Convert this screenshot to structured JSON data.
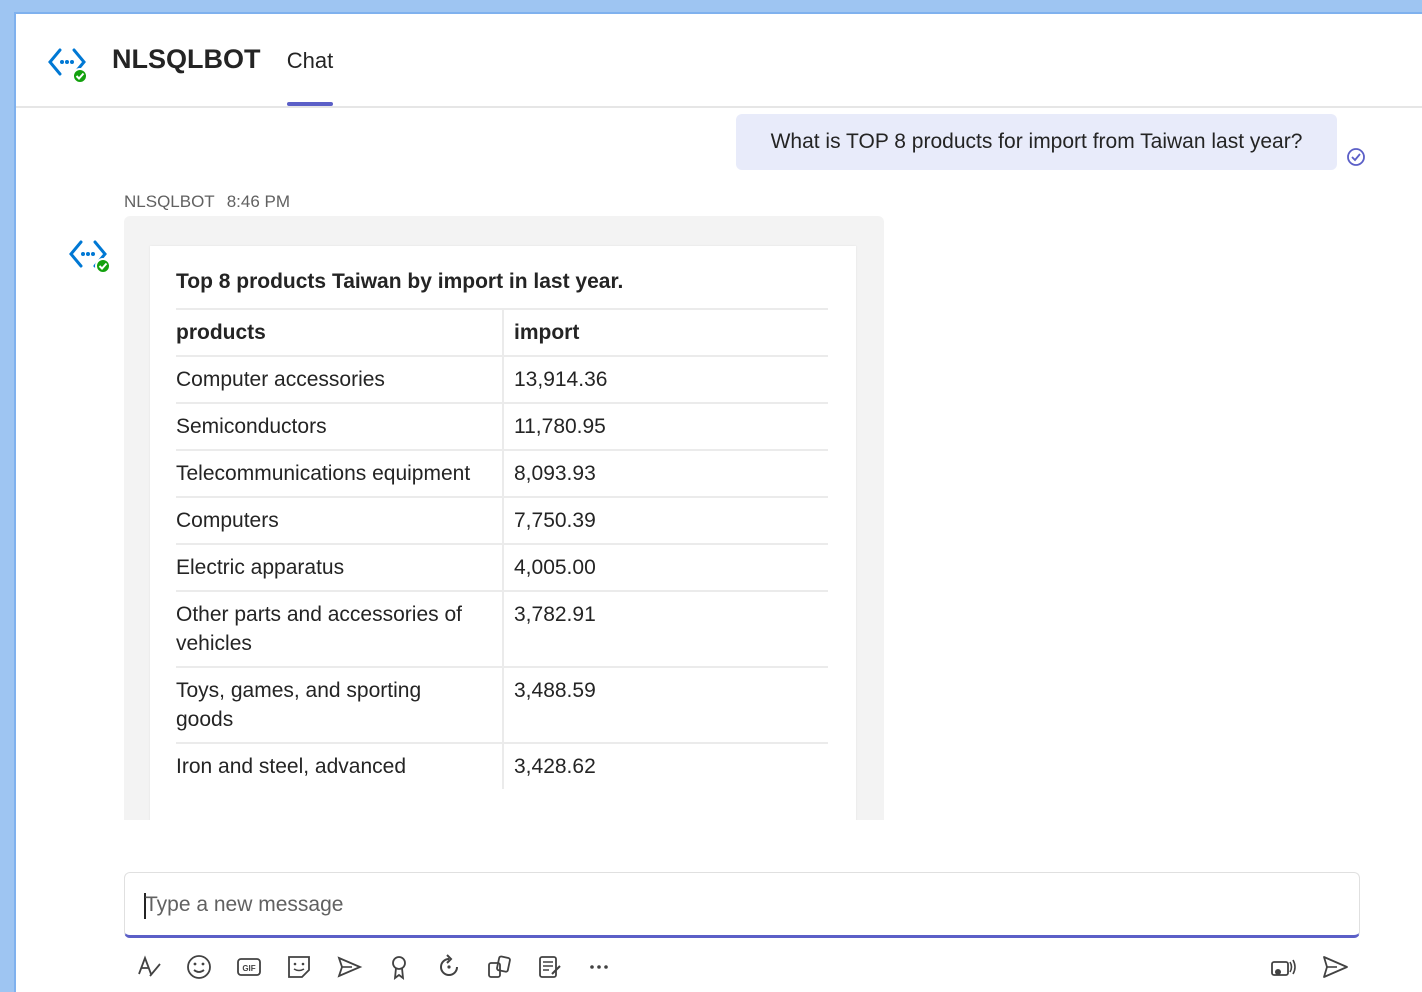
{
  "app": {
    "title": "NLSQLBOT",
    "tab_chat": "Chat"
  },
  "user_message": {
    "text": "What is TOP 8 products for import from Taiwan last year?"
  },
  "bot_message": {
    "sender": "NLSQLBOT",
    "time": "8:46 PM",
    "card_title": "Top 8 products Taiwan by import in last year.",
    "columns": [
      "products",
      "import"
    ],
    "rows": [
      {
        "product": "Computer accessories",
        "import": "13,914.36"
      },
      {
        "product": "Semiconductors",
        "import": "11,780.95"
      },
      {
        "product": "Telecommunications equipment",
        "import": "8,093.93"
      },
      {
        "product": "Computers",
        "import": "7,750.39"
      },
      {
        "product": "Electric apparatus",
        "import": "4,005.00"
      },
      {
        "product": "Other parts and accessories of vehicles",
        "import": "3,782.91"
      },
      {
        "product": "Toys, games, and sporting goods",
        "import": "3,488.59"
      },
      {
        "product": "Iron and steel, advanced",
        "import": "3,428.62"
      }
    ]
  },
  "composer": {
    "placeholder": "Type a new message"
  },
  "toolbar": {
    "icons": [
      "format-icon",
      "emoji-icon",
      "gif-icon",
      "sticker-icon",
      "schedule-send-icon",
      "praise-icon",
      "loop-icon",
      "apps-icon",
      "approvals-icon",
      "more-options-icon",
      "dictate-icon",
      "send-icon"
    ]
  },
  "colors": {
    "accent": "#5b5fc7",
    "bot_icon": "#0078d4",
    "status_green": "#13a10e"
  }
}
